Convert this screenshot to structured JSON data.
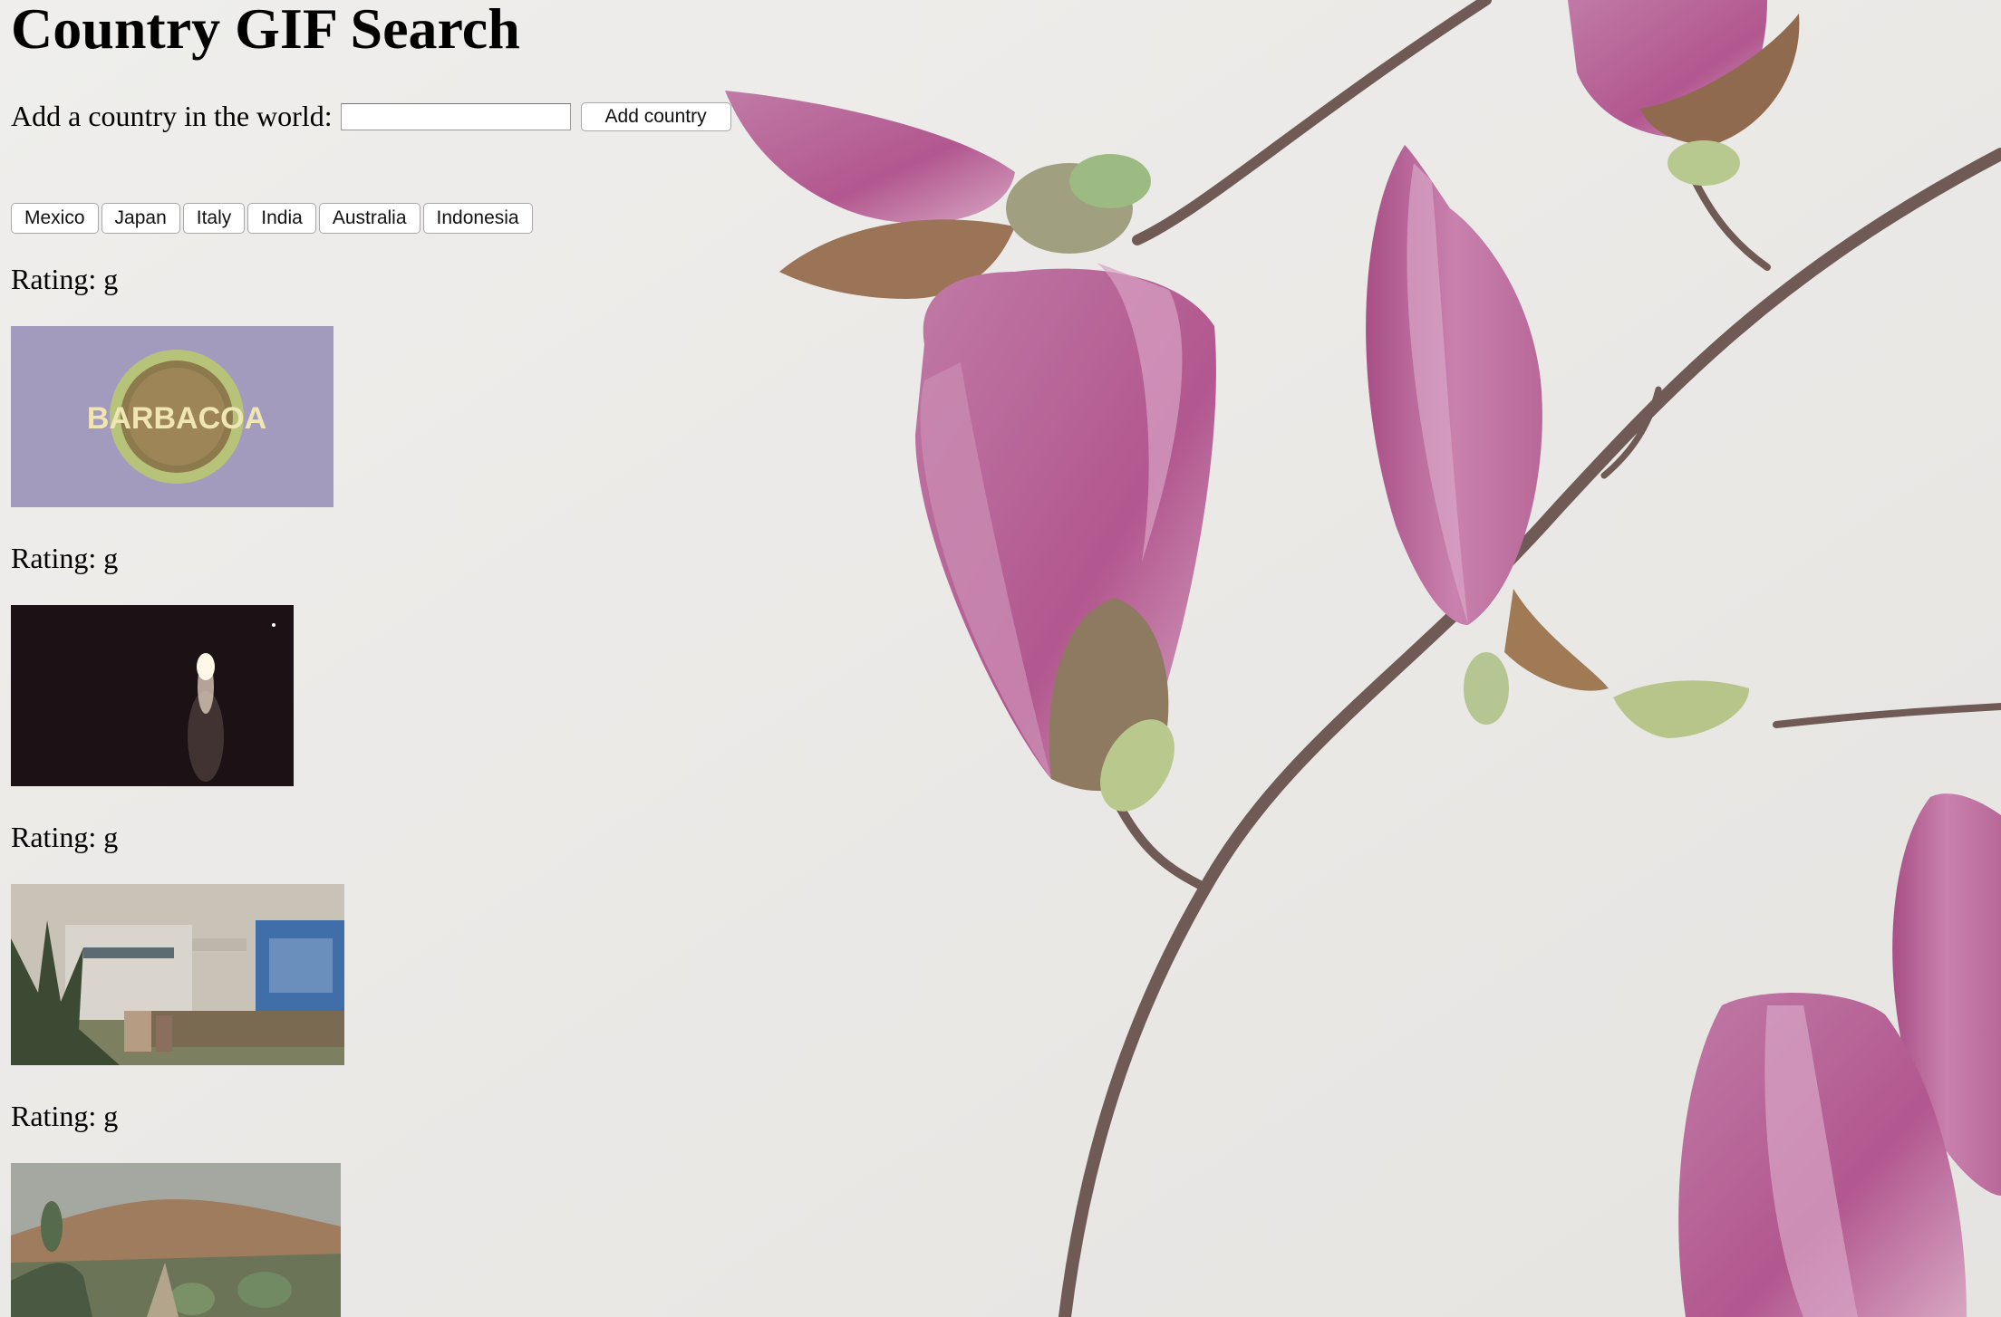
{
  "page": {
    "title": "Country GIF Search"
  },
  "form": {
    "label": "Add a country in the world:",
    "input_value": "",
    "input_placeholder": "",
    "submit_label": "Add country"
  },
  "countries": [
    "Mexico",
    "Japan",
    "Italy",
    "India",
    "Australia",
    "Indonesia"
  ],
  "gifs": [
    {
      "rating_text": "Rating: g",
      "overlay_text": "BARBACOA"
    },
    {
      "rating_text": "Rating: g"
    },
    {
      "rating_text": "Rating: g"
    },
    {
      "rating_text": "Rating: g"
    }
  ]
}
